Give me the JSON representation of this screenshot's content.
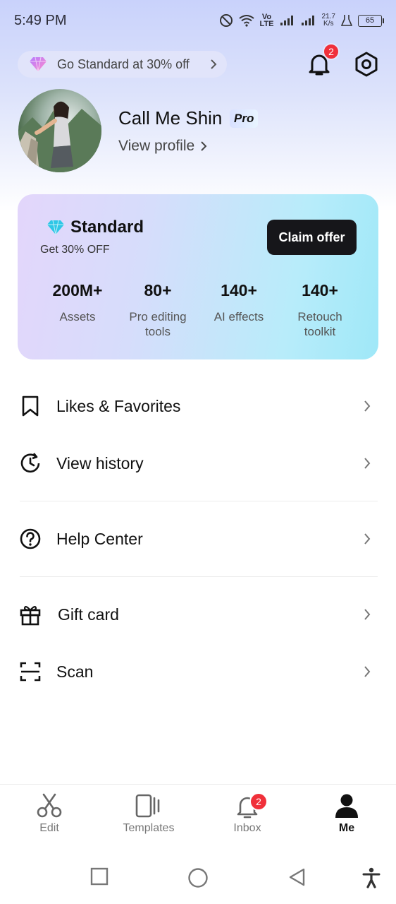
{
  "status_bar": {
    "time": "5:49 PM",
    "network_label": "Vo LTE",
    "speed_value": "21.7",
    "speed_unit": "K/s",
    "battery": "65"
  },
  "header": {
    "promo_text": "Go Standard at 30% off",
    "notification_count": "2"
  },
  "profile": {
    "name": "Call Me Shin",
    "badge": "Pro",
    "view_profile": "View profile"
  },
  "plan_card": {
    "title": "Standard",
    "subtitle": "Get 30% OFF",
    "cta": "Claim offer",
    "stats": [
      {
        "value": "200M+",
        "label": "Assets"
      },
      {
        "value": "80+",
        "label": "Pro editing tools"
      },
      {
        "value": "140+",
        "label": "AI effects"
      },
      {
        "value": "140+",
        "label": "Retouch toolkit"
      }
    ]
  },
  "menu": {
    "items": [
      {
        "label": "Likes & Favorites",
        "icon": "bookmark-icon"
      },
      {
        "label": "View history",
        "icon": "history-icon"
      },
      {
        "label": "Help Center",
        "icon": "help-icon"
      },
      {
        "label": "Gift card",
        "icon": "gift-icon"
      },
      {
        "label": "Scan",
        "icon": "scan-icon"
      }
    ]
  },
  "bottom_nav": {
    "items": [
      {
        "label": "Edit",
        "icon": "scissors-icon"
      },
      {
        "label": "Templates",
        "icon": "templates-icon"
      },
      {
        "label": "Inbox",
        "icon": "bell-icon"
      },
      {
        "label": "Me",
        "icon": "person-icon"
      }
    ],
    "inbox_badge": "2",
    "active": "Me"
  },
  "colors": {
    "accent_badge": "#f0303a",
    "cta_background": "#16161a",
    "card_gradient_start": "#e3d6fb",
    "card_gradient_end": "#9fe8f8"
  }
}
